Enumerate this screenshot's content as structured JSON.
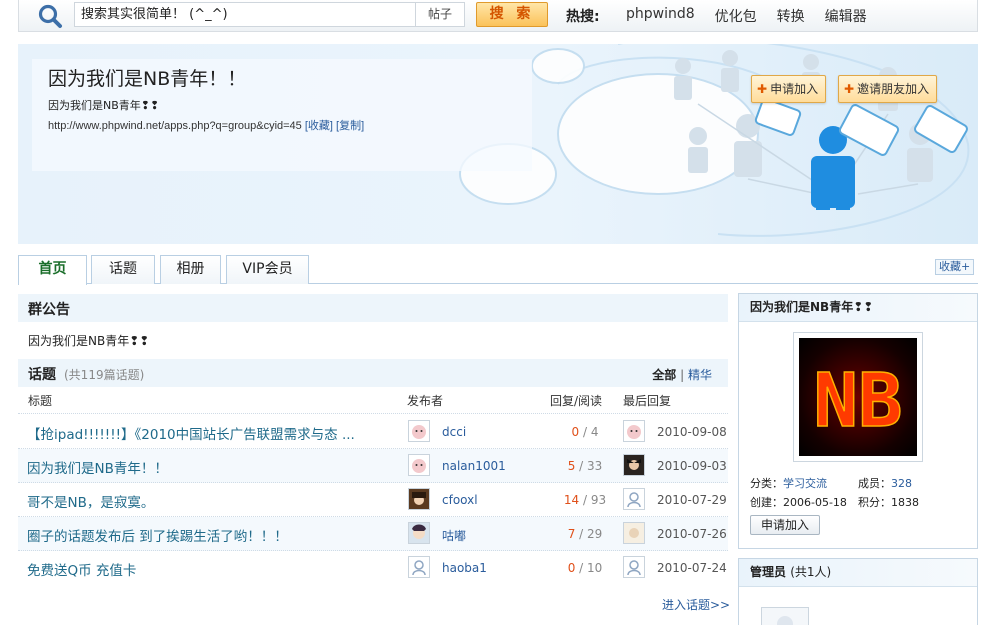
{
  "search": {
    "value": "搜索其实很简单！ (^_^)",
    "type": "帖子",
    "button": "搜 索",
    "hot_label": "热搜:",
    "hot_links": [
      "phpwind8",
      "优化包",
      "转换",
      "编辑器"
    ]
  },
  "group": {
    "title": "因为我们是NB青年！！",
    "desc": "因为我们是NB青年❢❢",
    "url": "http://www.phpwind.net/apps.php?q=group&cyid=45",
    "fav": "[收藏]",
    "copy": "[复制]",
    "join_label": "申请加入",
    "invite_label": "邀请朋友加入"
  },
  "tabs": [
    "首页",
    "话题",
    "相册",
    "VIP会员"
  ],
  "fav_label": "收藏",
  "announcement": {
    "heading": "群公告",
    "text": "因为我们是NB青年❢❢"
  },
  "topics": {
    "heading": "话题",
    "count": "(共119篇话题)",
    "filter_all": "全部",
    "filter_sep": "|",
    "filter_digest": "精华",
    "columns": [
      "标题",
      "发布者",
      "回复/阅读",
      "最后回复"
    ],
    "rows": [
      {
        "title": "【抢ipad!!!!!!!】《2010中国站长广告联盟需求与态 ...",
        "author": "dcci",
        "replies": "0",
        "views": "/ 4",
        "date": "2010-09-08"
      },
      {
        "title": "因为我们是NB青年！！",
        "author": "nalan1001",
        "replies": "5",
        "views": "/ 33",
        "date": "2010-09-03"
      },
      {
        "title": "哥不是NB，是寂寞。",
        "author": "cfooxl",
        "replies": "14",
        "views": "/ 93",
        "date": "2010-07-29"
      },
      {
        "title": "圈子的话题发布后 到了挨踢生活了哟！！！",
        "author": "咕嘟",
        "replies": "7",
        "views": "/ 29",
        "date": "2010-07-26"
      },
      {
        "title": "免费送Q币 充值卡",
        "author": "haoba1",
        "replies": "0",
        "views": "/ 10",
        "date": "2010-07-24"
      }
    ],
    "more": "进入话题>>"
  },
  "sidebar": {
    "title": "因为我们是NB青年❢❢",
    "logo_text": "NB",
    "category_label": "分类：",
    "category": "学习交流",
    "members_label": "成员：",
    "members": "328",
    "created_label": "创建：",
    "created": "2006-05-18",
    "points_label": "积分：",
    "points": "1838",
    "join_label": "申请加入",
    "admin_heading": "管理员",
    "admin_count": "(共1人)"
  },
  "colors": {
    "accent": "#1f6a8a",
    "link": "#2a5c9c",
    "reply_count": "#e0501a",
    "search_button": "#fbc25a"
  }
}
